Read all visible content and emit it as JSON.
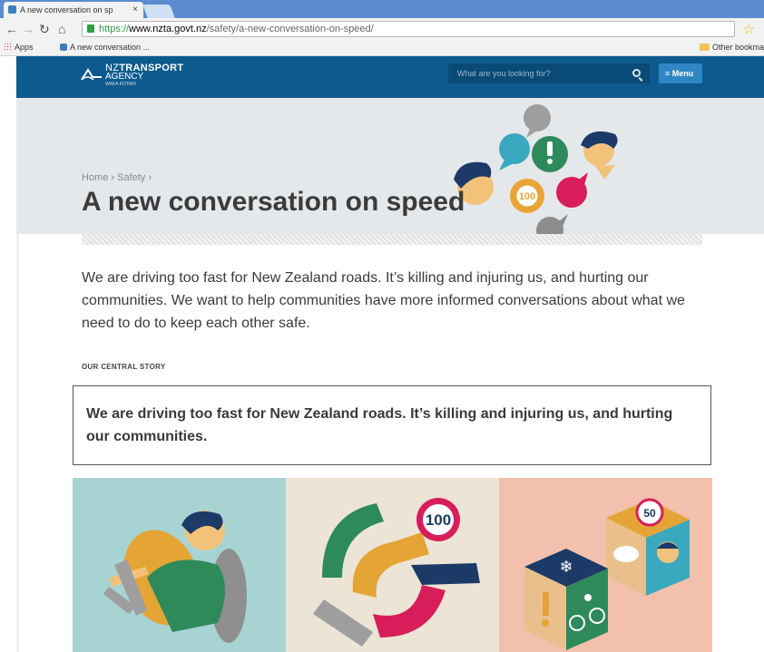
{
  "browser": {
    "tab_title": "A new conversation on sp",
    "tab_close": "×",
    "url_scheme": "https://",
    "url_host": "www.nzta.govt.nz",
    "url_path": "/safety/a-new-conversation-on-speed/",
    "bookmarks": {
      "apps": "Apps",
      "item": "A new conversation ...",
      "other": "Other bookma"
    }
  },
  "header": {
    "logo_line1": "TRANSPORT",
    "logo_prefix": "NZ",
    "logo_line2": "AGENCY",
    "logo_line3": "WAKA KOTAHI",
    "search_placeholder": "What are you looking for?",
    "menu_label": "≡ Menu"
  },
  "hero": {
    "breadcrumb": "Home › Safety ›",
    "title": "A new conversation on speed",
    "sign_value": "100"
  },
  "content": {
    "intro": "We are driving too fast for New Zealand roads. It’s killing and injuring us, and hurting our communities. We want to help communities have more informed conversations about what we need to do to keep each other safe.",
    "section_label": "OUR CENTRAL STORY",
    "central_story": "We are driving too fast for New Zealand roads. It’s killing and injuring us, and hurting our communities."
  },
  "tiles": [
    {
      "bg": "#a8d3d3"
    },
    {
      "bg": "#ece4d5",
      "sign_value": "100"
    },
    {
      "bg": "#f2c0ad",
      "sign_value": "50"
    }
  ],
  "colors": {
    "header_blue": "#0d5a8e",
    "menu_blue": "#2f86c4",
    "text_dark": "#3b3b3b"
  }
}
